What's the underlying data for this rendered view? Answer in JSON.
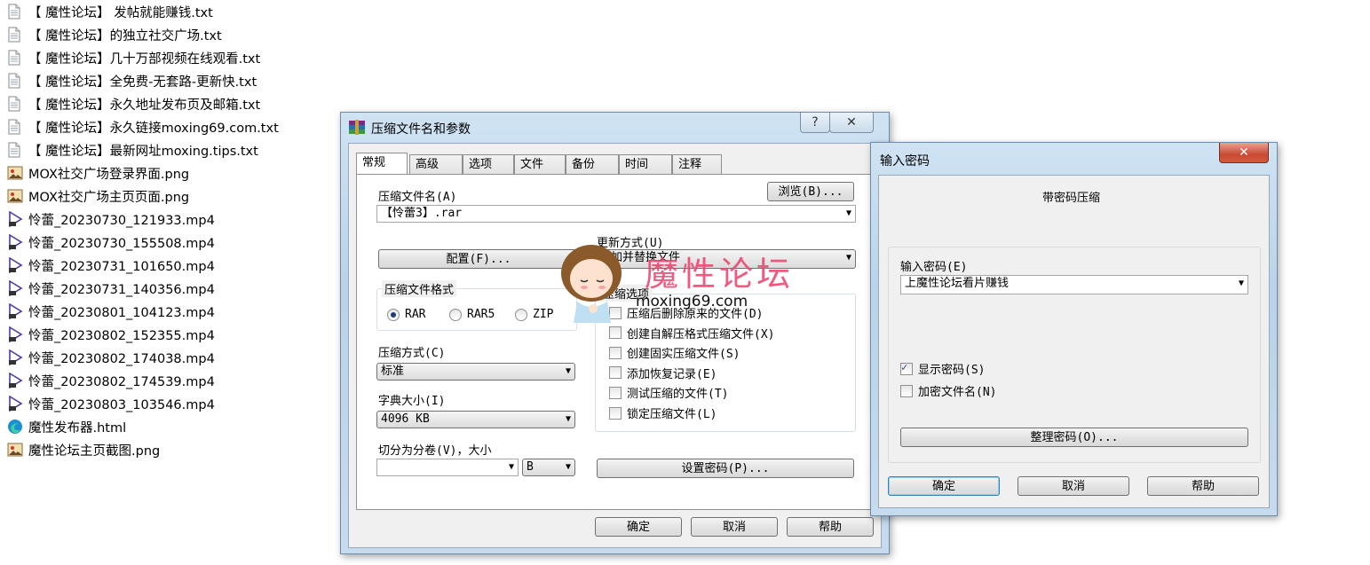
{
  "files": [
    {
      "name": "【 魔性论坛】 发帖就能赚钱.txt",
      "icon": "text-file-icon"
    },
    {
      "name": "【 魔性论坛】的独立社交广场.txt",
      "icon": "text-file-icon"
    },
    {
      "name": "【 魔性论坛】几十万部视频在线观看.txt",
      "icon": "text-file-icon"
    },
    {
      "name": "【 魔性论坛】全免费-无套路-更新快.txt",
      "icon": "text-file-icon"
    },
    {
      "name": "【 魔性论坛】永久地址发布页及邮箱.txt",
      "icon": "text-file-icon"
    },
    {
      "name": "【 魔性论坛】永久链接moxing69.com.txt",
      "icon": "text-file-icon"
    },
    {
      "name": "【 魔性论坛】最新网址moxing.tips.txt",
      "icon": "text-file-icon"
    },
    {
      "name": "MOX社交广场登录界面.png",
      "icon": "image-file-icon"
    },
    {
      "name": "MOX社交广场主页页面.png",
      "icon": "image-file-icon"
    },
    {
      "name": "怜蕾_20230730_121933.mp4",
      "icon": "video-file-icon"
    },
    {
      "name": "怜蕾_20230730_155508.mp4",
      "icon": "video-file-icon"
    },
    {
      "name": "怜蕾_20230731_101650.mp4",
      "icon": "video-file-icon"
    },
    {
      "name": "怜蕾_20230731_140356.mp4",
      "icon": "video-file-icon"
    },
    {
      "name": "怜蕾_20230801_104123.mp4",
      "icon": "video-file-icon"
    },
    {
      "name": "怜蕾_20230802_152355.mp4",
      "icon": "video-file-icon"
    },
    {
      "name": "怜蕾_20230802_174038.mp4",
      "icon": "video-file-icon"
    },
    {
      "name": "怜蕾_20230802_174539.mp4",
      "icon": "video-file-icon"
    },
    {
      "name": "怜蕾_20230803_103546.mp4",
      "icon": "video-file-icon"
    },
    {
      "name": "魔性发布器.html",
      "icon": "edge-browser-icon"
    },
    {
      "name": "魔性论坛主页截图.png",
      "icon": "image-file-icon"
    }
  ],
  "archive_dialog": {
    "title": "压缩文件名和参数",
    "help_glyph": "?",
    "close_glyph": "✕",
    "tabs": [
      "常规",
      "高级",
      "选项",
      "文件",
      "备份",
      "时间",
      "注释"
    ],
    "archive_name_label": "压缩文件名(A)",
    "browse_button": "浏览(B)...",
    "archive_name_value": "【怜蕾3】.rar",
    "update_mode_label": "更新方式(U)",
    "update_mode_value": "添加并替换文件",
    "profiles_button": "配置(F)...",
    "format_group": "压缩文件格式",
    "formats": [
      "RAR",
      "RAR5",
      "ZIP"
    ],
    "options_group": "压缩选项",
    "options": [
      {
        "label": "压缩后删除原来的文件(D)",
        "checked": false
      },
      {
        "label": "创建自解压格式压缩文件(X)",
        "checked": false
      },
      {
        "label": "创建固实压缩文件(S)",
        "checked": false
      },
      {
        "label": "添加恢复记录(E)",
        "checked": false
      },
      {
        "label": "测试压缩的文件(T)",
        "checked": false
      },
      {
        "label": "锁定压缩文件(L)",
        "checked": false
      }
    ],
    "method_label": "压缩方式(C)",
    "method_value": "标准",
    "dict_label": "字典大小(I)",
    "dict_value": "4096 KB",
    "split_label": "切分为分卷(V)，大小",
    "split_value": "",
    "split_unit": "B",
    "set_password_button": "设置密码(P)...",
    "ok": "确定",
    "cancel": "取消",
    "help": "帮助"
  },
  "password_dialog": {
    "title": "输入密码",
    "close_glyph": "✕",
    "heading": "带密码压缩",
    "password_label": "输入密码(E)",
    "password_value": "上魔性论坛看片赚钱",
    "show_password": "显示密码(S)",
    "encrypt_names": "加密文件名(N)",
    "organize_button": "整理密码(O)...",
    "ok": "确定",
    "cancel": "取消",
    "help": "帮助"
  },
  "watermark": {
    "text": "魔性论坛",
    "url": "moxing69.com"
  }
}
